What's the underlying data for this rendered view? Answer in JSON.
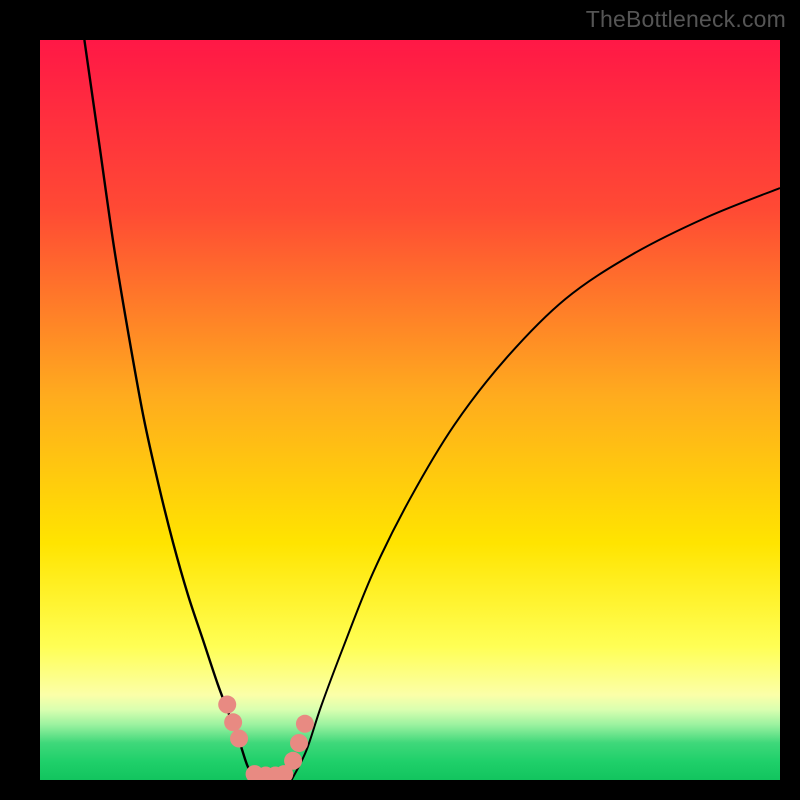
{
  "watermark": "TheBottleneck.com",
  "colors": {
    "black": "#000000",
    "grad_top": "#ff1846",
    "grad_mid1": "#ff6a2a",
    "grad_mid2": "#ffd400",
    "grad_low": "#ffff66",
    "grad_pale": "#faffb0",
    "grad_green": "#1fd56a",
    "curve": "#000000",
    "dot": "#e88a82"
  },
  "chart_data": {
    "type": "line",
    "title": "",
    "xlabel": "",
    "ylabel": "",
    "xlim": [
      0,
      100
    ],
    "ylim": [
      0,
      100
    ],
    "series": [
      {
        "name": "left-branch",
        "x": [
          6,
          8,
          10,
          12,
          14,
          16,
          18,
          20,
          22,
          24,
          25.5,
          27,
          28,
          29
        ],
        "y": [
          100,
          86,
          72,
          60,
          49,
          40,
          32,
          25,
          19,
          13,
          9,
          5,
          2,
          0
        ]
      },
      {
        "name": "right-branch",
        "x": [
          34,
          36,
          38,
          41,
          45,
          50,
          56,
          63,
          71,
          80,
          90,
          100
        ],
        "y": [
          0,
          4,
          10,
          18,
          28,
          38,
          48,
          57,
          65,
          71,
          76,
          80
        ]
      }
    ],
    "markers": {
      "name": "highlight-dots",
      "x": [
        25.3,
        26.1,
        26.9,
        29.0,
        30.5,
        31.8,
        33.0,
        34.2,
        35.0,
        35.8
      ],
      "y": [
        10.2,
        7.8,
        5.6,
        0.8,
        0.6,
        0.6,
        0.8,
        2.6,
        5.0,
        7.6
      ]
    },
    "gradient_stops": [
      {
        "offset": 0.0,
        "color": "#ff1846"
      },
      {
        "offset": 0.23,
        "color": "#ff4a34"
      },
      {
        "offset": 0.48,
        "color": "#ffab1e"
      },
      {
        "offset": 0.68,
        "color": "#ffe400"
      },
      {
        "offset": 0.82,
        "color": "#ffff55"
      },
      {
        "offset": 0.885,
        "color": "#fbffa8"
      },
      {
        "offset": 0.905,
        "color": "#d9ffb0"
      },
      {
        "offset": 0.925,
        "color": "#9cf2a0"
      },
      {
        "offset": 0.95,
        "color": "#3fd87a"
      },
      {
        "offset": 0.975,
        "color": "#1fd06a"
      },
      {
        "offset": 1.0,
        "color": "#12c45e"
      }
    ]
  }
}
